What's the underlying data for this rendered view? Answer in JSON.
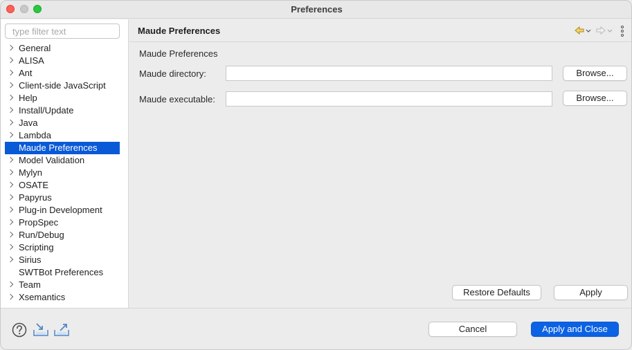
{
  "window": {
    "title": "Preferences"
  },
  "filter": {
    "placeholder": "type filter text",
    "value": ""
  },
  "tree": {
    "items": [
      {
        "label": "General",
        "expandable": true
      },
      {
        "label": "ALISA",
        "expandable": true
      },
      {
        "label": "Ant",
        "expandable": true
      },
      {
        "label": "Client-side JavaScript",
        "expandable": true
      },
      {
        "label": "Help",
        "expandable": true
      },
      {
        "label": "Install/Update",
        "expandable": true
      },
      {
        "label": "Java",
        "expandable": true
      },
      {
        "label": "Lambda",
        "expandable": true
      },
      {
        "label": "Maude Preferences",
        "expandable": false,
        "selected": true
      },
      {
        "label": "Model Validation",
        "expandable": true
      },
      {
        "label": "Mylyn",
        "expandable": true
      },
      {
        "label": "OSATE",
        "expandable": true
      },
      {
        "label": "Papyrus",
        "expandable": true
      },
      {
        "label": "Plug-in Development",
        "expandable": true
      },
      {
        "label": "PropSpec",
        "expandable": true
      },
      {
        "label": "Run/Debug",
        "expandable": true
      },
      {
        "label": "Scripting",
        "expandable": true
      },
      {
        "label": "Sirius",
        "expandable": true
      },
      {
        "label": "SWTBot Preferences",
        "expandable": false
      },
      {
        "label": "Team",
        "expandable": true
      },
      {
        "label": "Xsemantics",
        "expandable": true
      }
    ]
  },
  "page": {
    "title": "Maude Preferences",
    "section_label": "Maude Preferences",
    "maude_directory": {
      "label": "Maude directory:",
      "value": "",
      "browse_label": "Browse..."
    },
    "maude_executable": {
      "label": "Maude executable:",
      "value": "",
      "browse_label": "Browse..."
    },
    "restore_defaults_label": "Restore Defaults",
    "apply_label": "Apply"
  },
  "footer": {
    "cancel_label": "Cancel",
    "apply_close_label": "Apply and Close",
    "icons": [
      "help-icon",
      "import-icon",
      "export-icon"
    ]
  },
  "colors": {
    "selection": "#0a5ad7",
    "primary_button": "#0b62e3",
    "close": "#fe5f57",
    "maximize": "#28c840"
  }
}
